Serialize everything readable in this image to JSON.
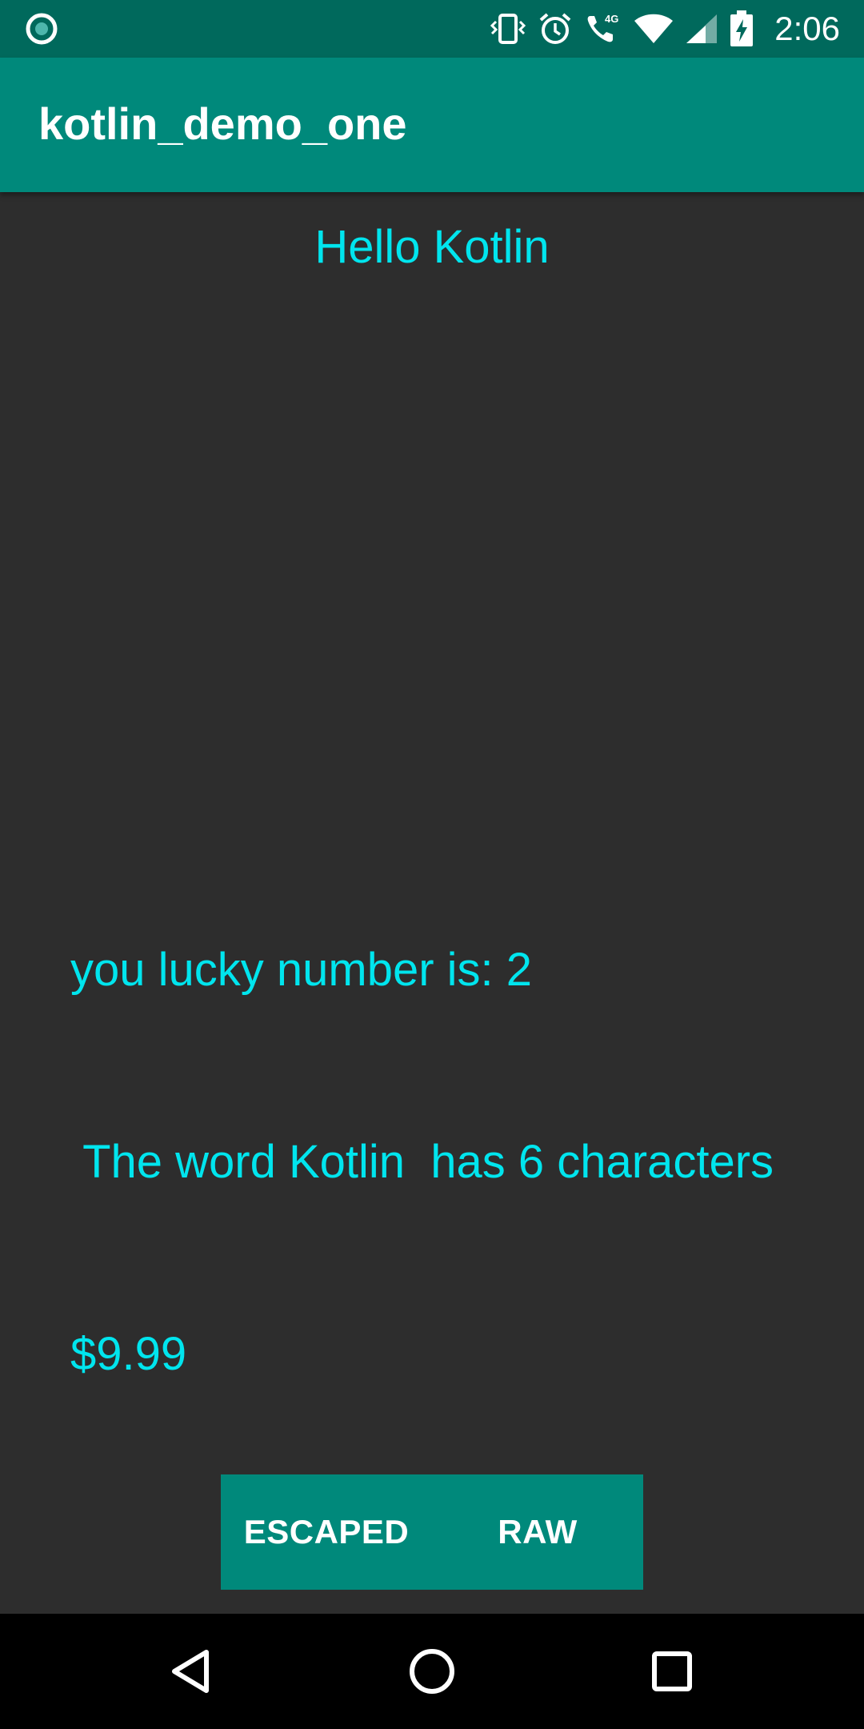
{
  "status_bar": {
    "time": "2:06",
    "network_type": "4G",
    "icons": [
      "notification-dot-icon",
      "vibrate-icon",
      "alarm-icon",
      "wifi-calling-icon",
      "wifi-icon",
      "cell-signal-icon",
      "battery-charging-icon"
    ]
  },
  "app_bar": {
    "title": "kotlin_demo_one"
  },
  "content": {
    "hello_text": "Hello Kotlin",
    "lines": [
      "you lucky number is: 2",
      " The word Kotlin  has 6 characters",
      "$9.99"
    ]
  },
  "buttons": {
    "escaped_label": "ESCAPED",
    "raw_label": "RAW"
  },
  "nav_bar": {
    "icons": [
      "back-icon",
      "home-icon",
      "recents-icon"
    ]
  },
  "colors": {
    "status_bar": "#00695c",
    "app_bar": "#00897b",
    "background": "#2d2d2d",
    "text_accent": "#00e5ee"
  }
}
